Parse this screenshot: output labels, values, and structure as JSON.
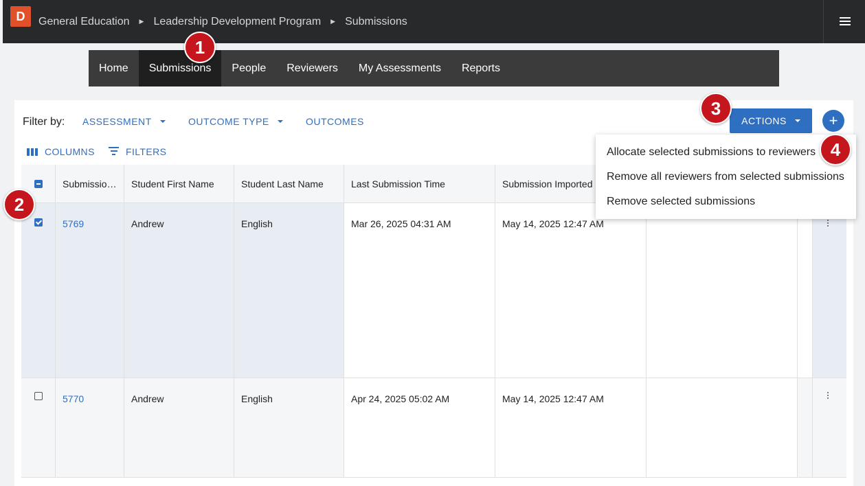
{
  "topbar": {
    "logo": "D",
    "breadcrumbs": [
      "General Education",
      "Leadership Development Program",
      "Submissions"
    ]
  },
  "nav": {
    "items": [
      "Home",
      "Submissions",
      "People",
      "Reviewers",
      "My Assessments",
      "Reports"
    ],
    "active": "Submissions"
  },
  "filters": {
    "label": "Filter by:",
    "assessment": "ASSESSMENT",
    "outcome_type": "OUTCOME TYPE",
    "outcomes": "OUTCOMES"
  },
  "toolbar": {
    "columns": "COLUMNS",
    "filters": "FILTERS",
    "actions": "ACTIONS",
    "add": "+"
  },
  "table": {
    "headers": [
      "Submissio…",
      "Student First Name",
      "Student Last Name",
      "Last Submission Time",
      "Submission Imported"
    ],
    "rows": [
      {
        "id": "5769",
        "first": "Andrew",
        "last": "English",
        "last_submission": "Mar 26, 2025 04:31 AM",
        "imported": "May 14, 2025 12:47 AM",
        "checked": true
      },
      {
        "id": "5770",
        "first": "Andrew",
        "last": "English",
        "last_submission": "Apr 24, 2025 05:02 AM",
        "imported": "May 14, 2025 12:47 AM",
        "checked": false
      }
    ]
  },
  "actions_menu": [
    "Allocate selected submissions to reviewers",
    "Remove all reviewers from selected submissions",
    "Remove selected submissions"
  ],
  "badges": [
    "1",
    "2",
    "3",
    "4"
  ],
  "colors": {
    "accent": "#2f6fc1",
    "badge": "#c4161c",
    "topbar": "#28292b",
    "nav": "#3b3b3b"
  }
}
